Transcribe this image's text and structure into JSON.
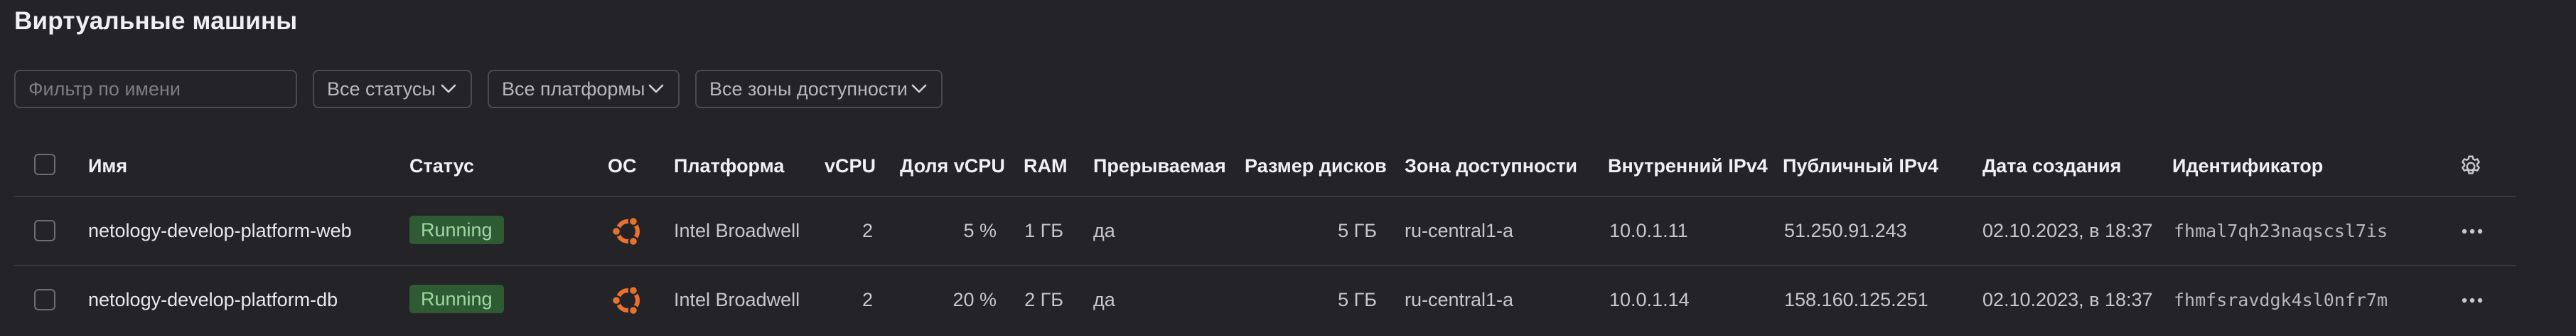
{
  "page": {
    "title": "Виртуальные машины"
  },
  "filters": {
    "name_placeholder": "Фильтр по имени",
    "status_label": "Все статусы",
    "platform_label": "Все платформы",
    "zone_label": "Все зоны доступности"
  },
  "table": {
    "headers": {
      "name": "Имя",
      "status": "Статус",
      "os": "ОС",
      "platform": "Платформа",
      "vcpu": "vCPU",
      "vcpu_share": "Доля vCPU",
      "ram": "RAM",
      "preemptible": "Прерываемая",
      "disk_size": "Размер дисков",
      "zone": "Зона доступности",
      "internal_ip": "Внутренний IPv4",
      "public_ip": "Публичный IPv4",
      "created": "Дата создания",
      "id": "Идентификатор"
    },
    "rows": [
      {
        "name": "netology-develop-platform-web",
        "status": "Running",
        "os_icon": "ubuntu-icon",
        "platform": "Intel Broadwell",
        "vcpu": "2",
        "vcpu_share": "5 %",
        "ram": "1 ГБ",
        "preemptible": "да",
        "disk_size": "5 ГБ",
        "zone": "ru-central1-a",
        "internal_ip": "10.0.1.11",
        "public_ip": "51.250.91.243",
        "created": "02.10.2023, в 18:37",
        "id": "fhmal7qh23naqscsl7is"
      },
      {
        "name": "netology-develop-platform-db",
        "status": "Running",
        "os_icon": "ubuntu-icon",
        "platform": "Intel Broadwell",
        "vcpu": "2",
        "vcpu_share": "20 %",
        "ram": "2 ГБ",
        "preemptible": "да",
        "disk_size": "5 ГБ",
        "zone": "ru-central1-a",
        "internal_ip": "10.0.1.14",
        "public_ip": "158.160.125.251",
        "created": "02.10.2023, в 18:37",
        "id": "fhmfsravdgk4sl0nfr7m"
      }
    ]
  },
  "colors": {
    "background": "#242428",
    "status_running_bg": "#2e5a34",
    "status_running_text": "#9fd7a2",
    "ubuntu_orange": "#e9722f"
  }
}
